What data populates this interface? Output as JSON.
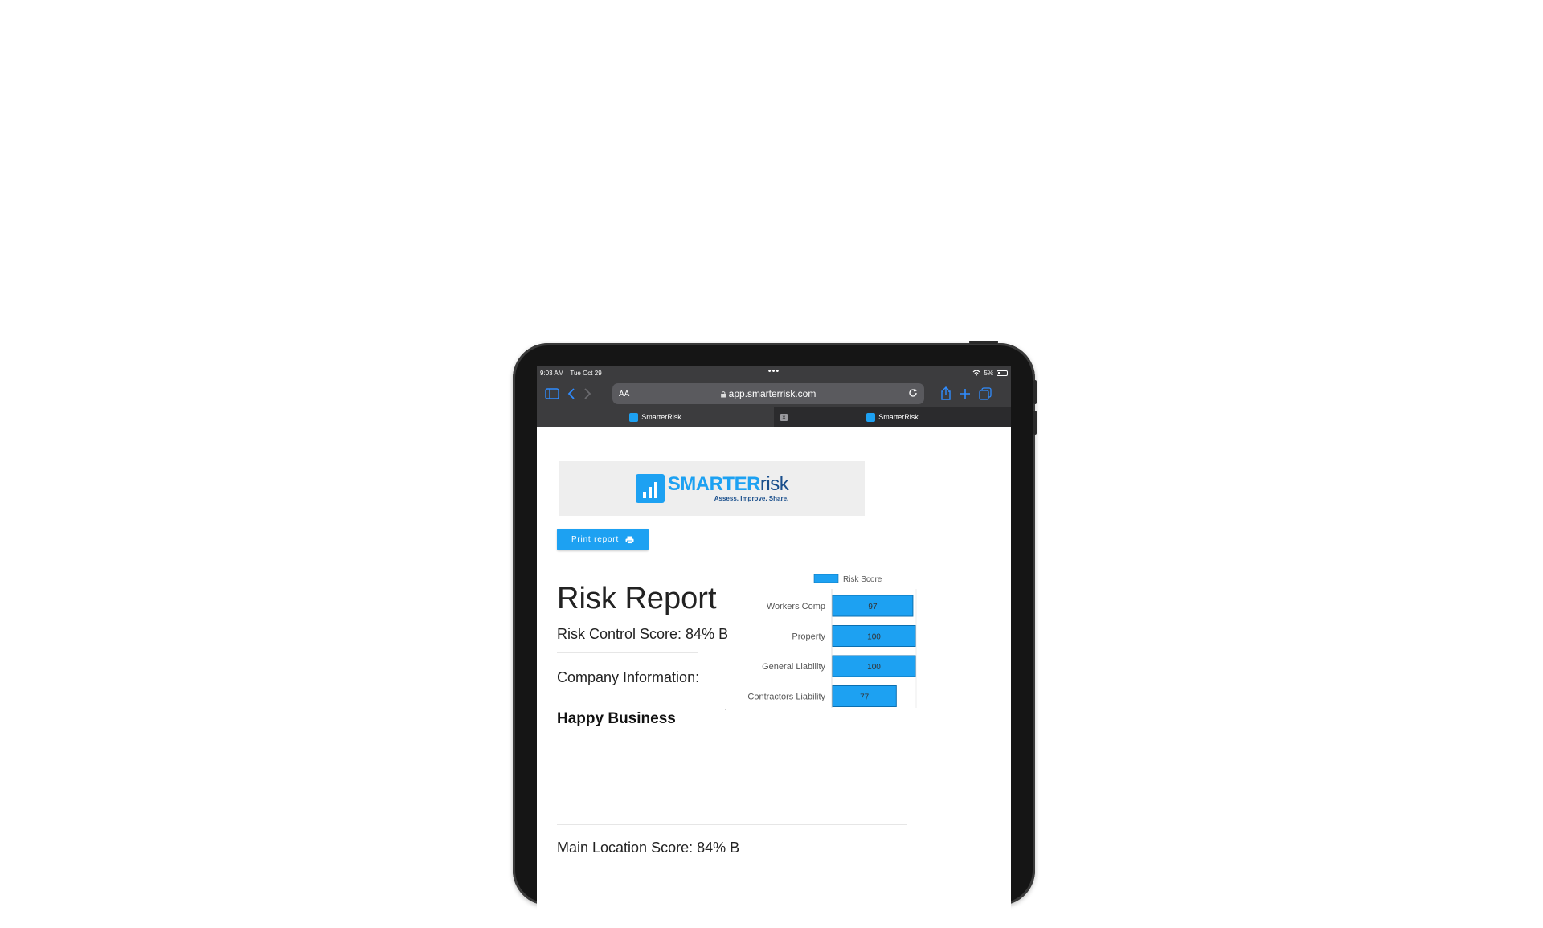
{
  "status_bar": {
    "time": "9:03 AM",
    "date": "Tue Oct 29",
    "battery": "5%"
  },
  "browser": {
    "text_size_label": "AA",
    "url": "app.smarterrisk.com",
    "tabs": [
      {
        "label": "SmarterRisk",
        "active": false
      },
      {
        "label": "SmarterRisk",
        "active": true
      }
    ]
  },
  "logo": {
    "brand_bold": "SMARTER",
    "brand_light": "risk",
    "tagline": "Assess. Improve. Share."
  },
  "page": {
    "print_button_label": "Print report",
    "title": "Risk Report",
    "risk_control_score": "Risk Control Score: 84% B",
    "company_info_label": "Company Information:",
    "company_name": "Happy Business",
    "main_location_score": "Main Location Score: 84% B"
  },
  "colors": {
    "accent": "#1da1f2",
    "toolbar_bg": "#3c3c3e",
    "browser_icon": "#2f8cff"
  },
  "chart_data": {
    "type": "bar",
    "orientation": "horizontal",
    "categories": [
      "Workers Comp",
      "Property",
      "General Liability",
      "Contractors Liability"
    ],
    "series": [
      {
        "name": "Risk Score",
        "values": [
          97,
          100,
          100,
          77
        ],
        "color": "#1da1f2"
      }
    ],
    "xlim": [
      0,
      100
    ],
    "legend": "top"
  }
}
